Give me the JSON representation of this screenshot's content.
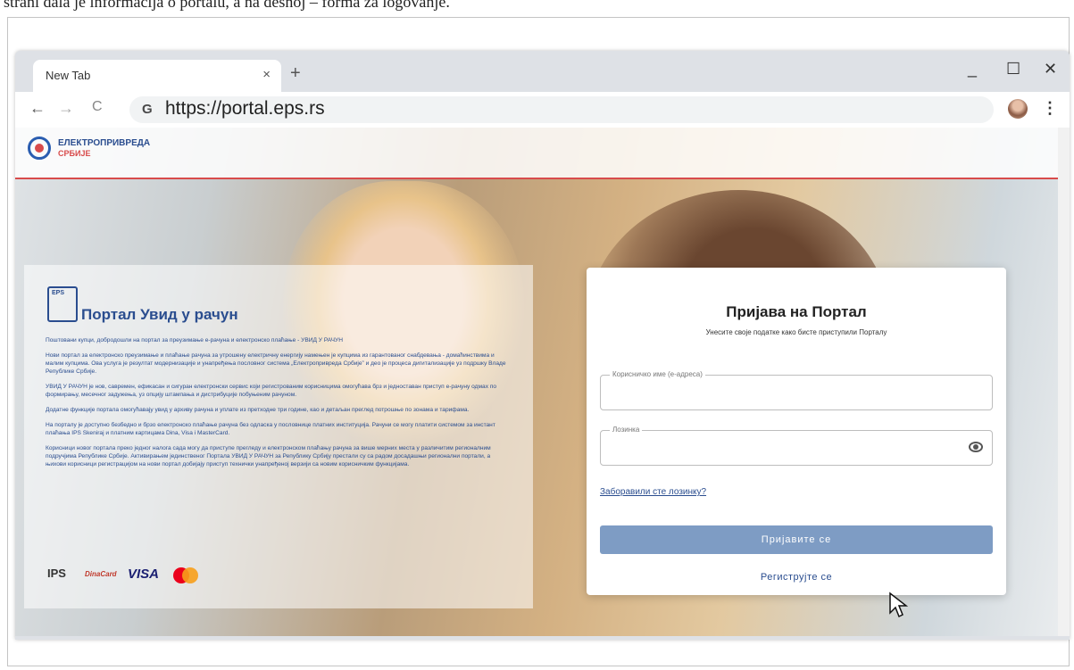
{
  "caption": "strani dala je informacija o portalu, a na desnoj – forma za logovanje.",
  "browser": {
    "tab_title": "New Tab",
    "tab_close": "×",
    "new_tab": "+",
    "minimize": "_",
    "maximize": "☐",
    "close": "✕",
    "back": "←",
    "forward": "→",
    "reload": "C",
    "url": "https://portal.eps.rs",
    "menu": "⋮"
  },
  "site": {
    "logo_line1": "ЕЛЕКТРОПРИВРЕДА",
    "logo_line2": "СРБИЈЕ"
  },
  "info": {
    "icon_label": "EPS",
    "title": "Портал Увид у рачун",
    "p1": "Поштовани купци, добродошли на портал за преузимање е-рачуна и електронско плаћање - УВИД У РАЧУН",
    "p2": "Нови портал за електронско преузимање и плаћање рачуна за утрошену електричну енергију намењен је купцима из гарантованог снабдевања - домаћинствима и малим купцима. Ова услуга је резултат модернизације и унапређења пословног система „Електропривреда Србије” и део је процеса дигитализације уз подршку Владе Републике Србије.",
    "p3": "УВИД У РАЧУН је нов, савремен, ефикасан и сигуран електронски сервис који регистрованим корисницима омогућава брз и једноставан приступ е-рачуну одмах по формирању, месечног задужења, уз опцију штампања и дистрибуције побуњеним рачуном.",
    "p4": "Додатне функције портала омогућавају увид у архиву рачуна и уплате из претходне три године, као и детаљан преглед потрошње по зонама и тарифама.",
    "p5": "На порталу је доступно безбедно и брзо електронско плаћање рачуна без одласка у пословнице платних институција. Рачуни се могу платити системом за инстант плаћања IPS Skeniraj и платним картицама Dina, Visa i MasterCard.",
    "p6": "Корисници новог портала преко једног налога сада могу да приступе прегледу и електронском плаћању рачуна за више мерних места у различитим регионалним подручјима Републике Србије. Активирањем јединственог Портала УВИД У РАЧУН за Републику Србију престали су са радом досадашњи регионални портали, а њихови корисници регистрацијом на нови портал добијају приступ технички унапређеној верзији са новим корисничким функцијама.",
    "pay_ips": "IPS",
    "pay_dina": "DinaCard",
    "pay_visa": "VISA"
  },
  "login": {
    "title": "Пријава на Портал",
    "subtitle": "Унесите своје податке како бисте приступили Порталу",
    "username_label": "Корисничко име (е-адреса)",
    "username_value": "",
    "password_label": "Лозинка",
    "password_value": "",
    "forgot": "Заборавили сте лозинку?",
    "submit": "Пријавите се",
    "register": "Региструјте се"
  },
  "colors": {
    "brand_blue": "#2a4d8f",
    "brand_red": "#d84b4b",
    "button": "#7e9cc4"
  }
}
